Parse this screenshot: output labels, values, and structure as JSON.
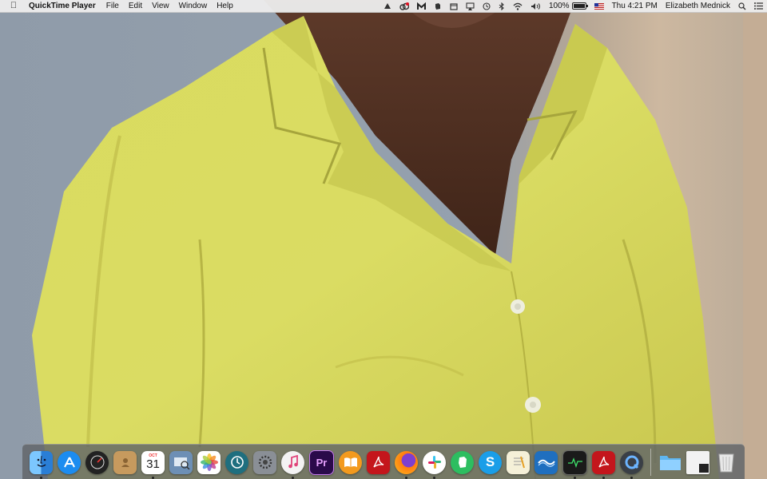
{
  "menubar": {
    "apple_icon": "apple-icon",
    "app_name": "QuickTime Player",
    "menus": [
      "File",
      "Edit",
      "View",
      "Window",
      "Help"
    ],
    "status": {
      "battery_percent": "100%",
      "clock": "Thu 4:21 PM",
      "user": "Elizabeth Mednick"
    }
  },
  "dock": {
    "apps": [
      {
        "name": "Finder",
        "icon": "finder-icon",
        "color": "#2f8ff0",
        "running": true
      },
      {
        "name": "App Store",
        "icon": "app-store-icon",
        "color": "#1c8cf0",
        "running": false
      },
      {
        "name": "Dashboard",
        "icon": "dashboard-icon",
        "color": "#222222",
        "running": false
      },
      {
        "name": "Contacts",
        "icon": "contacts-icon",
        "color": "#c79a5e",
        "running": false
      },
      {
        "name": "Calendar",
        "icon": "calendar-icon",
        "color": "#ffffff",
        "running": true,
        "badge_text": "31",
        "month_text": "OCT"
      },
      {
        "name": "Preview",
        "icon": "preview-icon",
        "color": "#6d8fb5",
        "running": false
      },
      {
        "name": "Photos",
        "icon": "photos-icon",
        "color": "#ffffff",
        "running": false
      },
      {
        "name": "Time Machine",
        "icon": "time-machine-icon",
        "color": "#1f6f7f",
        "running": false
      },
      {
        "name": "System Preferences",
        "icon": "gear-icon",
        "color": "#8a8f96",
        "running": false
      },
      {
        "name": "iTunes",
        "icon": "music-icon",
        "color": "#f3f3f3",
        "running": true
      },
      {
        "name": "Premiere Pro",
        "icon": "premiere-icon",
        "color": "#2a0a4a",
        "running": false,
        "label": "Pr"
      },
      {
        "name": "iBooks",
        "icon": "books-icon",
        "color": "#f39a1e",
        "running": false
      },
      {
        "name": "Acrobat",
        "icon": "acrobat-icon",
        "color": "#c4161c",
        "running": false
      },
      {
        "name": "Firefox",
        "icon": "firefox-icon",
        "color": "#ff7b12",
        "running": true
      },
      {
        "name": "Slack",
        "icon": "slack-icon",
        "color": "#ffffff",
        "running": true
      },
      {
        "name": "Evernote",
        "icon": "evernote-icon",
        "color": "#2dbe60",
        "running": false
      },
      {
        "name": "Skype",
        "icon": "skype-icon",
        "color": "#1a9ee8",
        "running": false
      },
      {
        "name": "TextEdit",
        "icon": "textedit-icon",
        "color": "#f5f0d8",
        "running": false
      },
      {
        "name": "Mail Client",
        "icon": "mail-icon",
        "color": "#1f6fbf",
        "running": false
      },
      {
        "name": "Activity Monitor",
        "icon": "activity-monitor-icon",
        "color": "#1a1a1a",
        "running": true
      },
      {
        "name": "Acrobat Reader",
        "icon": "acrobat-reader-icon",
        "color": "#c4161c",
        "running": true
      },
      {
        "name": "QuickTime Player",
        "icon": "quicktime-icon",
        "color": "#3a3f46",
        "running": true
      }
    ],
    "folders": [
      {
        "name": "Downloads",
        "icon": "folder-icon",
        "color": "#5fb6f0"
      },
      {
        "name": "Desktop stack",
        "icon": "stack-icon",
        "color": "#f2f2f2"
      },
      {
        "name": "Trash",
        "icon": "trash-icon",
        "color": "#e8e8e8"
      }
    ]
  }
}
